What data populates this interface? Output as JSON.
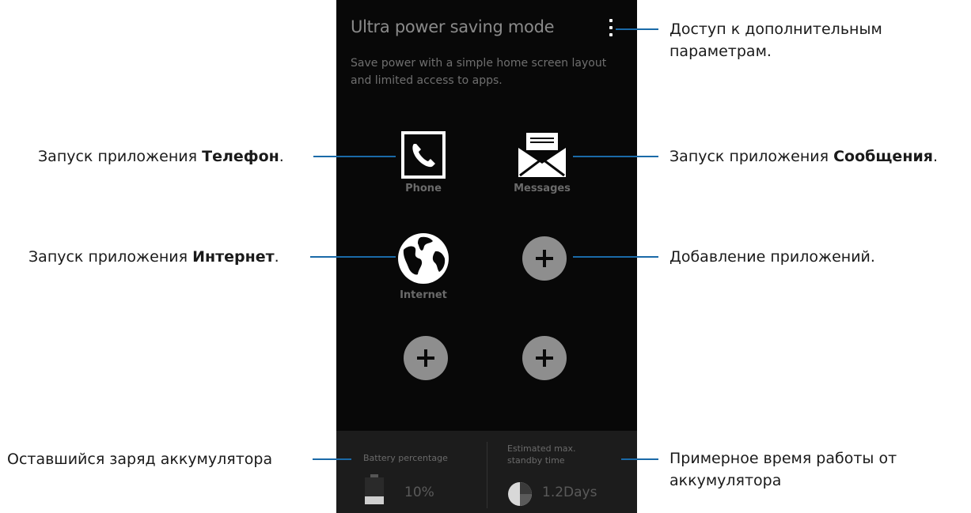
{
  "screen": {
    "title": "Ultra power saving mode",
    "description": "Save power with a simple home screen layout and limited access to apps.",
    "apps": [
      {
        "label": "Phone",
        "icon": "phone-icon"
      },
      {
        "label": "Messages",
        "icon": "envelope-icon"
      },
      {
        "label": "Internet",
        "icon": "globe-icon"
      }
    ],
    "add_icon": "plus-icon",
    "battery": {
      "title": "Battery percentage",
      "value": "10%",
      "icon": "battery-icon"
    },
    "standby": {
      "title_line1": "Estimated max.",
      "title_line2": "standby time",
      "value": "1.2Days",
      "icon": "pie-clock-icon"
    }
  },
  "callouts": {
    "options": {
      "line1": "Доступ к дополнительным",
      "line2": "параметрам."
    },
    "phone": {
      "prefix": "Запуск приложения ",
      "bold": "Телефон",
      "suffix": "."
    },
    "messages": {
      "prefix": "Запуск приложения ",
      "bold": "Сообщения",
      "suffix": "."
    },
    "internet": {
      "prefix": "Запуск приложения ",
      "bold": "Интернет",
      "suffix": "."
    },
    "add_apps": {
      "text": "Добавление приложений."
    },
    "battery": {
      "text": "Оставшийся заряд аккумулятора"
    },
    "standby": {
      "line1": "Примерное время работы от",
      "line2": "аккумулятора"
    }
  },
  "colors": {
    "screen_bg": "#080808",
    "callout_line": "#1a6aa8",
    "add_button": "#8e8e8e"
  }
}
